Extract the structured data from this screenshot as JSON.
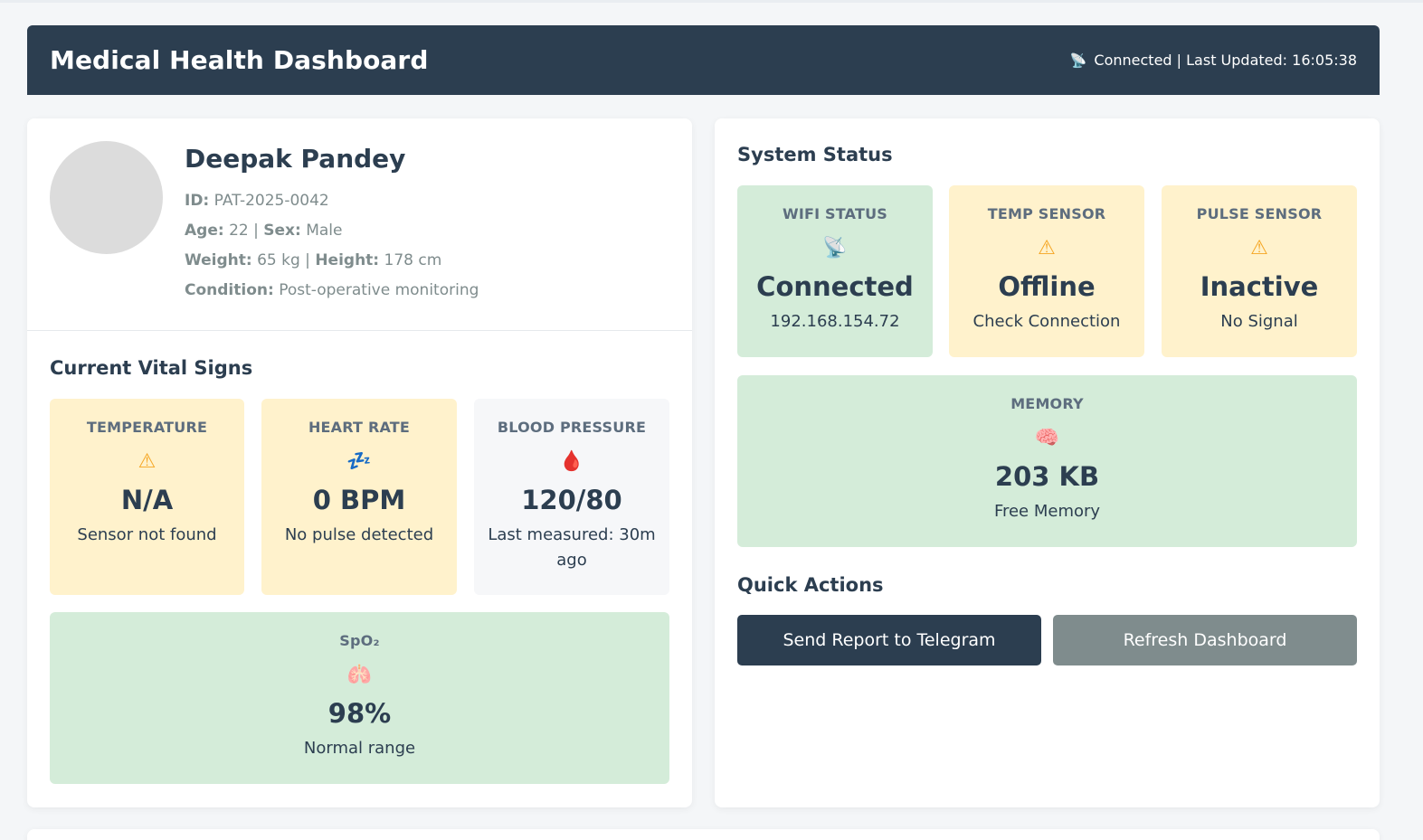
{
  "header": {
    "title": "Medical Health Dashboard",
    "status_icon": "satellite-antenna-icon",
    "status_text": "Connected | Last Updated: 16:05:38"
  },
  "patient": {
    "name": "Deepak Pandey",
    "id_label": "ID:",
    "id": "PAT-2025-0042",
    "age_label": "Age:",
    "age": "22",
    "sex_label": "Sex:",
    "sex": "Male",
    "weight_label": "Weight:",
    "weight": "65 kg",
    "height_label": "Height:",
    "height": "178 cm",
    "condition_label": "Condition:",
    "condition": "Post-operative monitoring"
  },
  "vitals": {
    "title": "Current Vital Signs",
    "temperature": {
      "label": "TEMPERATURE",
      "icon": "warning-icon",
      "glyph": "⚠",
      "value": "N/A",
      "sub": "Sensor not found"
    },
    "heart_rate": {
      "label": "HEART RATE",
      "icon": "sleeping-zzz-icon",
      "glyph": "💤",
      "value": "0 BPM",
      "sub": "No pulse detected"
    },
    "blood_pressure": {
      "label": "BLOOD PRESSURE",
      "icon": "blood-drop-icon",
      "glyph": "🩸",
      "value": "120/80",
      "sub": "Last measured: 30m ago"
    },
    "spo2": {
      "label": "SpO₂",
      "icon": "lungs-icon",
      "glyph": "🫁",
      "value": "98%",
      "sub": "Normal range"
    }
  },
  "system": {
    "title": "System Status",
    "wifi": {
      "label": "WIFI STATUS",
      "icon": "satellite-antenna-icon",
      "glyph": "📡",
      "value": "Connected",
      "sub": "192.168.154.72"
    },
    "temp_sensor": {
      "label": "TEMP SENSOR",
      "icon": "warning-icon",
      "glyph": "⚠",
      "value": "Offline",
      "sub": "Check Connection"
    },
    "pulse_sensor": {
      "label": "PULSE SENSOR",
      "icon": "warning-icon",
      "glyph": "⚠",
      "value": "Inactive",
      "sub": "No Signal"
    },
    "memory": {
      "label": "MEMORY",
      "icon": "brain-icon",
      "glyph": "🧠",
      "value": "203 KB",
      "sub": "Free Memory"
    }
  },
  "actions": {
    "title": "Quick Actions",
    "send_report": "Send Report to Telegram",
    "refresh": "Refresh Dashboard"
  },
  "colors": {
    "header_bg": "#2c3e50",
    "warn_bg": "#fff2cc",
    "ok_bg": "#d4ecd9",
    "neutral_bg": "#f6f7f9",
    "secondary_btn": "#7f8c8d"
  }
}
